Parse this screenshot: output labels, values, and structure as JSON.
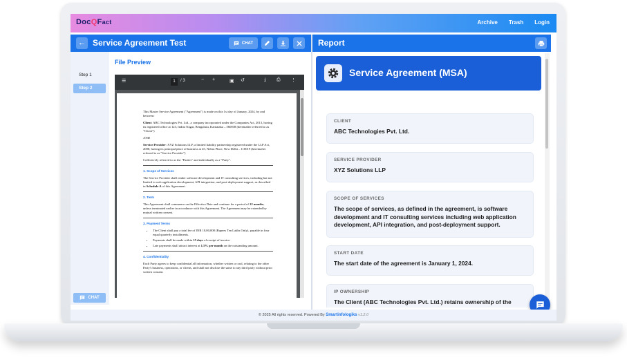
{
  "app": {
    "logo": {
      "part1": "Doc",
      "q": "Q",
      "part2": "F",
      "part3": "act"
    },
    "nav": [
      {
        "label": "Archive"
      },
      {
        "label": "Trash"
      },
      {
        "label": "Login"
      }
    ]
  },
  "left_panel": {
    "title": "Service Agreement Test",
    "chat_label": "CHAT",
    "steps": [
      {
        "label": "Step 1",
        "active": false
      },
      {
        "label": "Step 2",
        "active": true
      }
    ],
    "side_chat_label": "CHAT",
    "file_preview_title": "File Preview"
  },
  "pdf": {
    "current_page": "1",
    "total_pages": "/ 3",
    "intro": "This Master Service Agreement (\"Agreement\") is made on this 1st day of January, 2024, by and between:",
    "client_label": "Client",
    "client_text": ": ABC Technologies Pvt. Ltd., a company incorporated under the Companies Act, 2013, having its registered office at 123, Indira Nagar, Bengaluru, Karnataka – 560038 (hereinafter referred to as \"Client\")",
    "and": "AND",
    "provider_label": "Service Provider",
    "provider_text": ": XYZ Solutions LLP, a limited liability partnership registered under the LLP Act, 2008, having its principal place of business at 45, Nehru Place, New Delhi – 110019 (hereinafter referred to as \"Service Provider\")",
    "collective": "Collectively referred to as the \"Parties\" and individually as a \"Party\".",
    "s1_title": "1. Scope of Services",
    "s1_text_a": "The Service Provider shall render software development and IT consulting services, including but not limited to web application development, API integration, and post-deployment support, as described in ",
    "s1_bold": "Schedule A",
    "s1_text_b": " of this Agreement.",
    "s2_title": "2. Term",
    "s2_text_a": "This Agreement shall commence on the Effective Date and continue for a period of ",
    "s2_bold": "12 months",
    "s2_text_b": ", unless terminated earlier in accordance with this Agreement. The Agreement may be extended by mutual written consent.",
    "s3_title": "3. Payment Terms",
    "s3_b1": "The Client shall pay a total fee of INR 10,00,000 (Rupees Ten Lakhs Only), payable in four equal quarterly installments.",
    "s3_b2_a": "Payments shall be made within ",
    "s3_b2_bold": "15 days",
    "s3_b2_b": " of receipt of invoice.",
    "s3_b3_a": "Late payments shall attract interest at ",
    "s3_b3_bold": "1.5% per month",
    "s3_b3_b": " on the outstanding amount.",
    "s4_title": "4. Confidentiality",
    "s4_text": "Each Party agrees to keep confidential all information, whether written or oral, relating to the other Party's business, operations, or clients, and shall not disclose the same to any third party without prior written consent."
  },
  "right_panel": {
    "title": "Report",
    "banner_title": "Service Agreement (MSA)",
    "cards": [
      {
        "label": "CLIENT",
        "value": "ABC Technologies Pvt. Ltd."
      },
      {
        "label": "SERVICE PROVIDER",
        "value": "XYZ Solutions LLP"
      },
      {
        "label": "SCOPE OF SERVICES",
        "value": "The scope of services, as defined in the agreement, is software development and IT consulting services including web application development, API integration, and post-deployment support."
      },
      {
        "label": "START DATE",
        "value": "The start date of the agreement is January 1, 2024."
      },
      {
        "label": "IP OWNERSHIP",
        "value": "The Client (ABC Technologies Pvt. Ltd.) retains ownership of the intellectual property developed or shared under the agreement."
      }
    ]
  },
  "footer": {
    "text": "© 2025 All rights reserved. Powered By",
    "brand": "Smartinfologiks",
    "version": "v1.2.0"
  },
  "colors": {
    "primary": "#1a73e8",
    "banner": "#1a5fd8",
    "accent_pink": "#f0356f"
  }
}
